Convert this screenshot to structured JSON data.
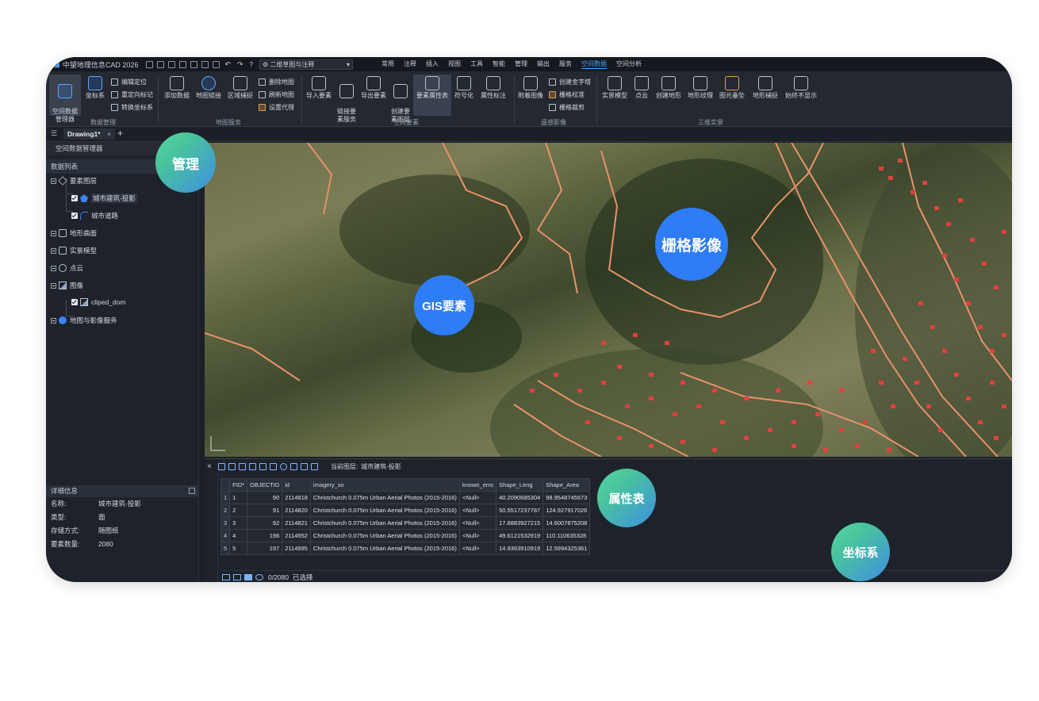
{
  "app": {
    "title": "中望地理信息CAD 2026",
    "workspace": "二维草图与注释",
    "menus": [
      "常用",
      "注释",
      "插入",
      "视图",
      "工具",
      "智能",
      "管理",
      "输出",
      "服务",
      "空间数据",
      "空间分析"
    ],
    "active_menu": "空间数据"
  },
  "ribbon": {
    "b_spatial_mgr": "空间数据\n管理器",
    "b_coord": "坐标系",
    "s_edit_pos": "编辑定位",
    "s_redirect": "重定向标记",
    "s_convert": "转换坐标系",
    "g_data_mgmt": "数据管理",
    "b_add_data": "添加数据",
    "b_map_link": "地图链接",
    "b_region": "区域捕捉",
    "s_del_map": "删除地图",
    "s_refresh_map": "刷新地图",
    "s_proxy": "设置代理",
    "g_map_service": "地图服务",
    "b_import": "导入要素",
    "b_link_svc": "链接要\n素服务",
    "b_export": "导出要素",
    "b_create_layer": "创建要\n素图层",
    "b_attr_table": "要素属性表",
    "b_symbolize": "符号化",
    "b_label": "属性标注",
    "g_spatial": "空间要素",
    "b_attach_img": "附着图像",
    "s_pyramid": "创建金字塔",
    "s_calib": "栅格校准",
    "s_clip": "栅格裁剪",
    "g_remote": "遥感影像",
    "b_reality": "实景模型",
    "b_cloud": "点云",
    "b_terrain": "创建地形",
    "b_texture": "地形纹理",
    "b_drape": "图元垂坠",
    "b_tsnap": "地形捕捉",
    "b_hide": "始终不显示",
    "g_3d": "三维实景"
  },
  "tab": {
    "name": "Drawing1*",
    "close": "×",
    "plus": "+"
  },
  "left": {
    "title": "空间数据管理器",
    "list_title": "数据列表",
    "tree": {
      "feature_layers": "要素图层",
      "building": "城市建筑-投影",
      "road": "城市道路",
      "terrain": "地形曲面",
      "reality": "实景模型",
      "cloud": "点云",
      "image": "图像",
      "cliped": "cliped_dom",
      "mapservice": "地图与影像服务"
    },
    "detail": {
      "title": "详细信息",
      "rows": [
        {
          "k": "名称:",
          "v": "城市建筑-投影"
        },
        {
          "k": "类型:",
          "v": "面"
        },
        {
          "k": "存储方式:",
          "v": "随图纸"
        },
        {
          "k": "要素数量:",
          "v": "2080"
        }
      ]
    }
  },
  "attr": {
    "current_layer_label": "当前图层:",
    "current_layer": "城市建筑-投影",
    "close": "×",
    "columns": [
      "",
      "FID*",
      "OBJECTID",
      "id",
      "imagery_so",
      "known_erro",
      "Shape_Leng",
      "Shape_Area"
    ],
    "rows": [
      [
        "1",
        "1",
        "90",
        "2114818",
        "Christchurch 0.075m Urban Aerial Photos (2015-2016)",
        "<Null>",
        "40.2090685304",
        "98.9548745673"
      ],
      [
        "2",
        "2",
        "91",
        "2114820",
        "Christchurch 0.075m Urban Aerial Photos (2015-2016)",
        "<Null>",
        "50.5517237787",
        "124.927917026"
      ],
      [
        "3",
        "3",
        "92",
        "2114821",
        "Christchurch 0.075m Urban Aerial Photos (2015-2016)",
        "<Null>",
        "17.8883927215",
        "14.6007875208"
      ],
      [
        "4",
        "4",
        "196",
        "2114952",
        "Christchurch 0.075m Urban Aerial Photos (2015-2016)",
        "<Null>",
        "49.6121532919",
        "110.110635328"
      ],
      [
        "5",
        "5",
        "197",
        "2114995",
        "Christchurch 0.075m Urban Aerial Photos (2015-2016)",
        "<Null>",
        "14.9363910919",
        "12.5994325361"
      ]
    ],
    "footer_count": "0/2080",
    "footer_selected": "已选择"
  },
  "bubbles": {
    "manage": "管理",
    "raster": "栅格影像",
    "gis": "GIS要素",
    "attr": "属性表",
    "coord": "坐标系"
  },
  "colors": {
    "accent": "#4aa3ff",
    "bubble_blue": "#2e7cf6",
    "bubble_green": "#57d6a9",
    "building_red": "#e2403f",
    "road_orange": "#e8916a"
  }
}
